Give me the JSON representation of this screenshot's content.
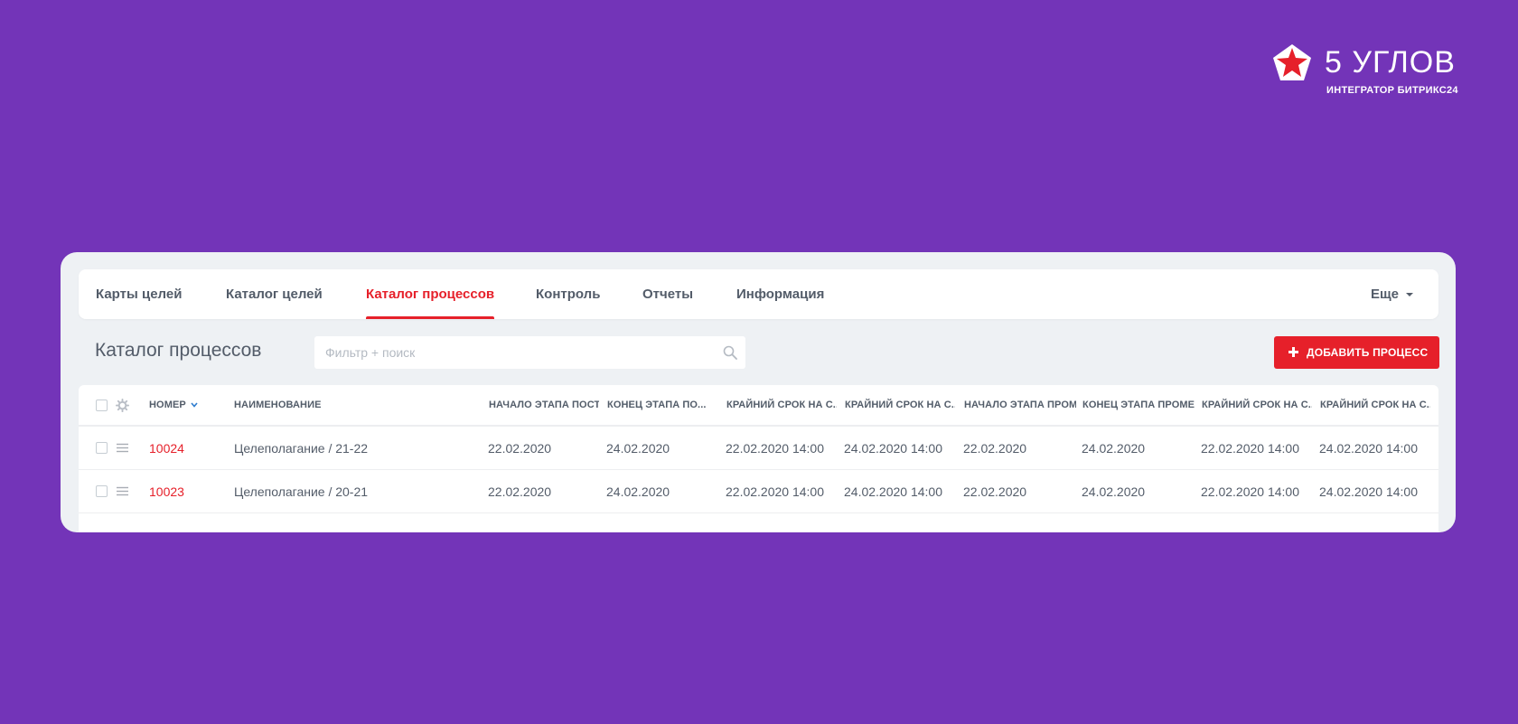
{
  "brand": {
    "name": "5 УГЛОВ",
    "subtitle": "ИНТЕГРАТОР БИТРИКС24",
    "logo_icon": "star-pentagon-logo-icon",
    "colors": {
      "red": "#e6202a",
      "white": "#ffffff"
    }
  },
  "nav": {
    "tabs": [
      {
        "label": "Карты целей"
      },
      {
        "label": "Каталог целей"
      },
      {
        "label": "Каталог процессов",
        "active": true
      },
      {
        "label": "Контроль"
      },
      {
        "label": "Отчеты"
      },
      {
        "label": "Информация"
      }
    ],
    "more_label": "Еще"
  },
  "page": {
    "title": "Каталог процессов"
  },
  "search": {
    "placeholder": "Фильтр + поиск",
    "value": "",
    "icon": "search-icon"
  },
  "toolbar": {
    "add_label": "ДОБАВИТЬ ПРОЦЕСС"
  },
  "table": {
    "columns": [
      {
        "label": "НОМЕР",
        "sorted": "desc"
      },
      {
        "label": "НАИМЕНОВАНИЕ"
      },
      {
        "label": "НАЧАЛО ЭТАПА ПОСТ..."
      },
      {
        "label": "КОНЕЦ ЭТАПА ПО..."
      },
      {
        "label": "КРАЙНИЙ СРОК НА С..."
      },
      {
        "label": "КРАЙНИЙ СРОК НА С..."
      },
      {
        "label": "НАЧАЛО ЭТАПА ПРОМ..."
      },
      {
        "label": "КОНЕЦ ЭТАПА ПРОМЕ..."
      },
      {
        "label": "КРАЙНИЙ СРОК НА С..."
      },
      {
        "label": "КРАЙНИЙ СРОК НА С..."
      }
    ],
    "rows": [
      {
        "cells": [
          "10024",
          "Целеполагание / 21-22",
          "22.02.2020",
          "24.02.2020",
          "22.02.2020 14:00",
          "24.02.2020 14:00",
          "22.02.2020",
          "24.02.2020",
          "22.02.2020 14:00",
          "24.02.2020 14:00"
        ]
      },
      {
        "cells": [
          "10023",
          "Целеполагание / 20-21",
          "22.02.2020",
          "24.02.2020",
          "22.02.2020 14:00",
          "24.02.2020 14:00",
          "22.02.2020",
          "24.02.2020",
          "22.02.2020 14:00",
          "24.02.2020 14:00"
        ]
      }
    ]
  },
  "colors": {
    "background": "#7334b8",
    "panel": "#eef1f4",
    "accent": "#e6202a",
    "text": "#535c69"
  }
}
